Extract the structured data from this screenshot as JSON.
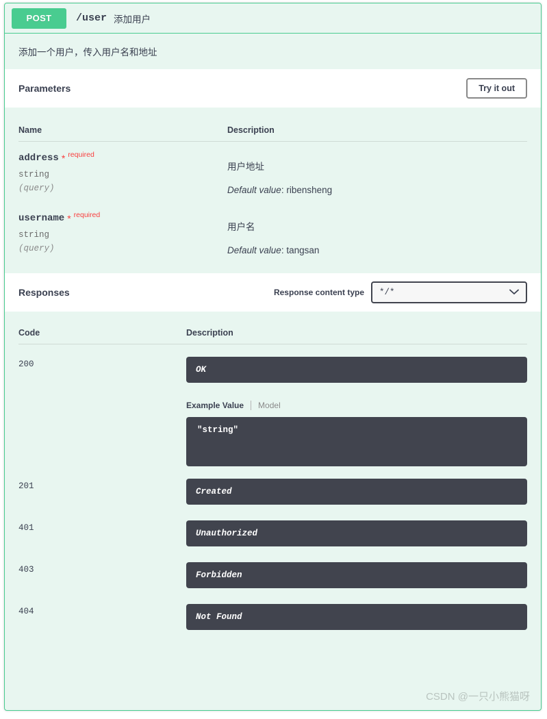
{
  "operation": {
    "method": "POST",
    "path": "/user",
    "summary": "添加用户",
    "description": "添加一个用户，传入用户名和地址",
    "method_color": "#49cc90"
  },
  "parameters_section": {
    "title": "Parameters",
    "try_it_out_label": "Try it out",
    "columns": {
      "name": "Name",
      "description": "Description"
    },
    "rows": [
      {
        "name": "address",
        "required_star": "*",
        "required_label": "required",
        "type": "string",
        "in": "(query)",
        "description": "用户地址",
        "default_label": "Default value",
        "default_separator": ":",
        "default_value": "ribensheng"
      },
      {
        "name": "username",
        "required_star": "*",
        "required_label": "required",
        "type": "string",
        "in": "(query)",
        "description": "用户名",
        "default_label": "Default value",
        "default_separator": ":",
        "default_value": "tangsan"
      }
    ]
  },
  "responses_section": {
    "title": "Responses",
    "content_type_label": "Response content type",
    "content_type_value": "*/*",
    "columns": {
      "code": "Code",
      "description": "Description"
    },
    "rows": [
      {
        "code": "200",
        "message": "OK",
        "example_tab": "Example Value",
        "model_tab": "Model",
        "example_body": "\"string\""
      },
      {
        "code": "201",
        "message": "Created"
      },
      {
        "code": "401",
        "message": "Unauthorized"
      },
      {
        "code": "403",
        "message": "Forbidden"
      },
      {
        "code": "404",
        "message": "Not Found"
      }
    ]
  },
  "watermark": "CSDN @一只小熊猫呀"
}
